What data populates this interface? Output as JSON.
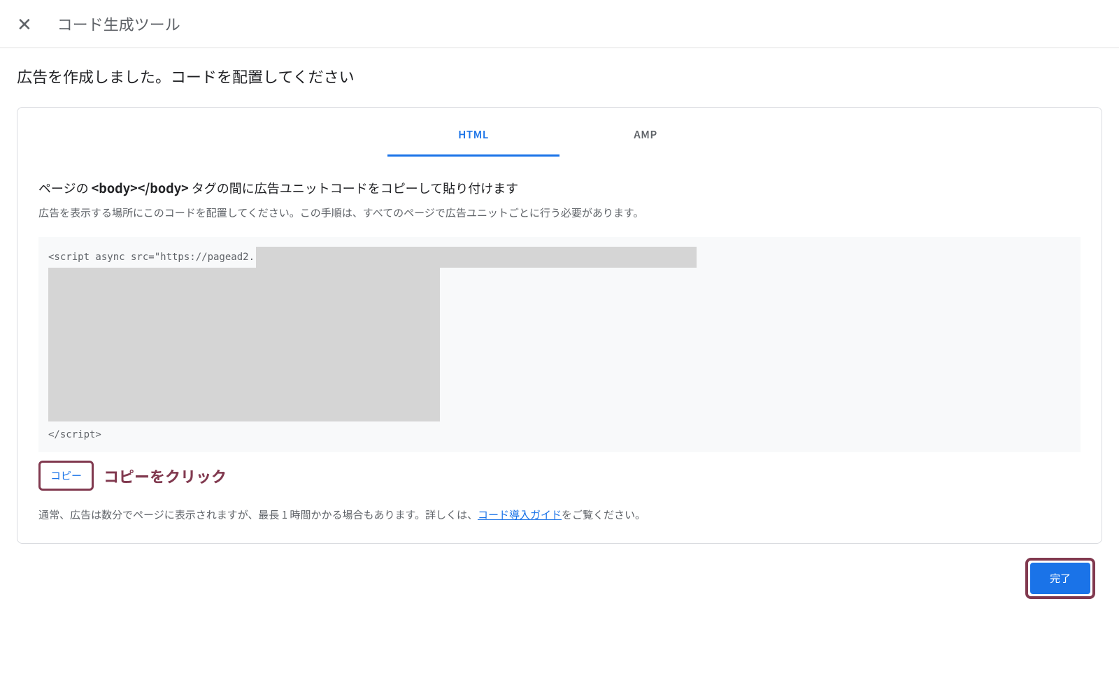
{
  "header": {
    "close_icon": "✕",
    "title": "コード生成ツール"
  },
  "page": {
    "title": "広告を作成しました。コードを配置してください"
  },
  "tabs": {
    "html": "HTML",
    "amp": "AMP"
  },
  "instruction": {
    "title_prefix": "ページの ",
    "title_bold": "<body></body>",
    "title_suffix": " タグの間に広告ユニットコードをコピーして貼り付けます",
    "desc": "広告を表示する場所にこのコードを配置してください。この手順は、すべてのページで広告ユニットごとに行う必要があります。"
  },
  "code": {
    "line1": "<script async src=\"https://pagead2.",
    "line_last": "</script>"
  },
  "copy": {
    "button_label": "コピー",
    "annotation": "コピーをクリック"
  },
  "footer": {
    "text_before": "通常、広告は数分でページに表示されますが、最長 1 時間かかる場合もあります。詳しくは、",
    "link_text": "コード導入ガイド",
    "text_after": "をご覧ください。"
  },
  "done": {
    "button_label": "完了"
  }
}
